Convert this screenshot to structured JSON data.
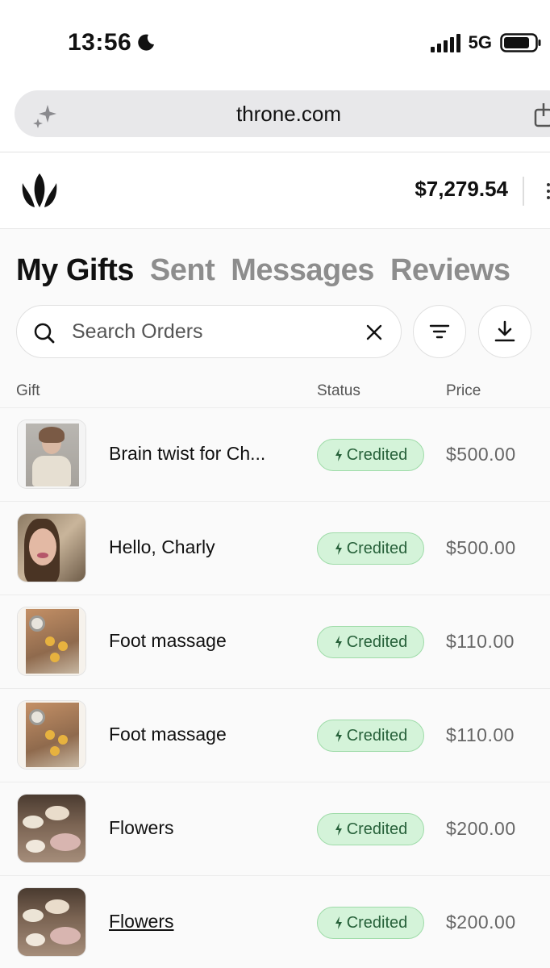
{
  "status_bar": {
    "time": "13:56",
    "network": "5G"
  },
  "browser": {
    "url": "throne.com"
  },
  "header": {
    "balance": "$7,279.54"
  },
  "tabs": [
    {
      "label": "My Gifts",
      "active": true
    },
    {
      "label": "Sent",
      "active": false
    },
    {
      "label": "Messages",
      "active": false
    },
    {
      "label": "Reviews",
      "active": false
    }
  ],
  "search": {
    "placeholder": "Search Orders",
    "value": ""
  },
  "table": {
    "headers": {
      "gift": "Gift",
      "status": "Status",
      "price": "Price"
    },
    "rows": [
      {
        "name": "Brain twist for Ch...",
        "status": "Credited",
        "price": "$500.00",
        "underline": false
      },
      {
        "name": "Hello, Charly",
        "status": "Credited",
        "price": "$500.00",
        "underline": false
      },
      {
        "name": "Foot massage",
        "status": "Credited",
        "price": "$110.00",
        "underline": false
      },
      {
        "name": "Foot massage",
        "status": "Credited",
        "price": "$110.00",
        "underline": false
      },
      {
        "name": "Flowers",
        "status": "Credited",
        "price": "$200.00",
        "underline": false
      },
      {
        "name": "Flowers",
        "status": "Credited",
        "price": "$200.00",
        "underline": true
      }
    ]
  },
  "colors": {
    "credited_bg": "#d4f3d9",
    "credited_border": "#9edba8",
    "credited_text": "#27613a",
    "tab_inactive": "#8d8d8d"
  },
  "icons": {
    "status": [
      "moon-icon",
      "signal-icon",
      "battery-icon"
    ],
    "browser": [
      "sparkle-icon",
      "share-icon"
    ],
    "header": [
      "throne-crown-logo",
      "menu-dots-icon"
    ],
    "toolbar": [
      "search-icon",
      "clear-icon",
      "filter-icon",
      "download-icon"
    ],
    "badge": "bolt-icon"
  }
}
